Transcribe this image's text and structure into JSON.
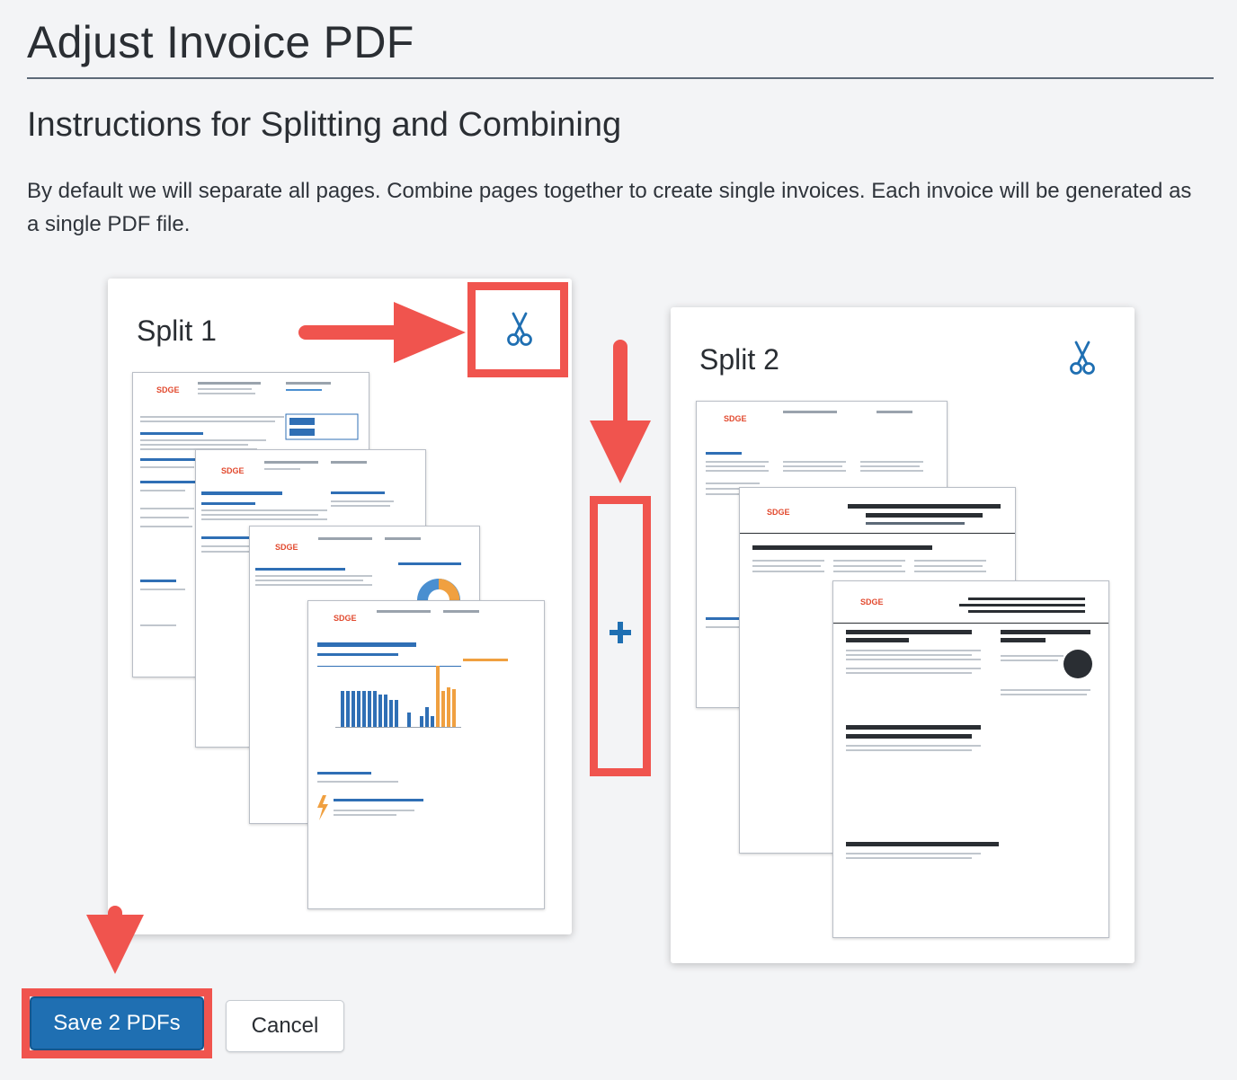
{
  "header": {
    "title": "Adjust Invoice PDF"
  },
  "section": {
    "title": "Instructions for Splitting and Combining",
    "description": "By default we will separate all pages. Combine pages together to create single invoices. Each invoice will be generated as a single PDF file."
  },
  "splits": [
    {
      "label": "Split 1",
      "split_icon": "scissors-icon"
    },
    {
      "label": "Split 2",
      "split_icon": "scissors-icon"
    }
  ],
  "combine_button": {
    "icon": "plus-icon",
    "symbol": "+"
  },
  "footer": {
    "save_label": "Save 2 PDFs",
    "cancel_label": "Cancel"
  },
  "colors": {
    "accent": "#1f6fb2",
    "annotation_red": "#f0544e",
    "background": "#f3f4f6",
    "rule": "#5d6a78"
  }
}
